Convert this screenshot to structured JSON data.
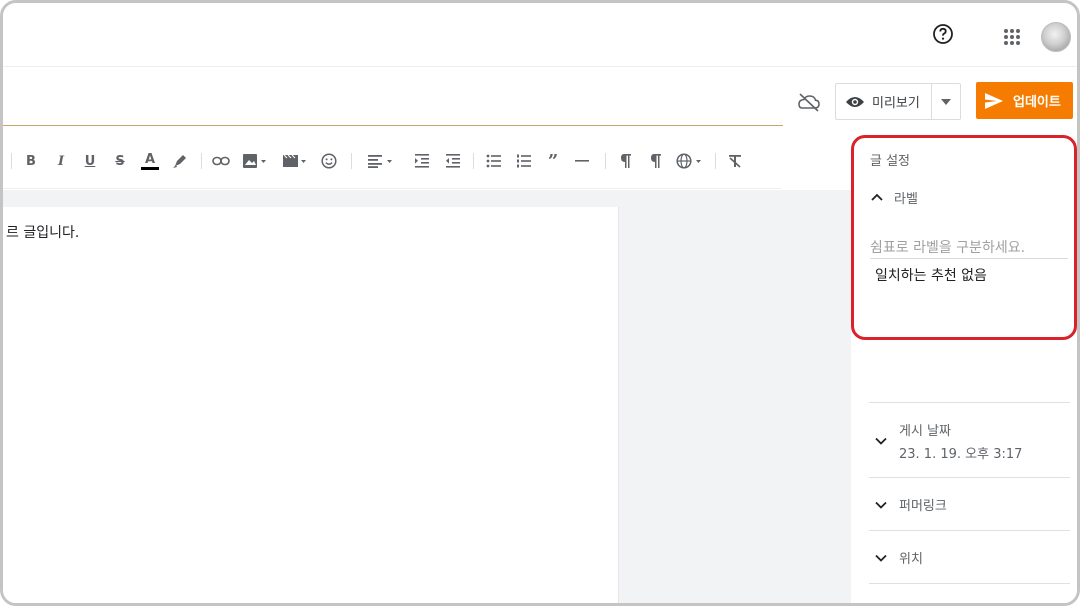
{
  "header": {
    "help_icon": "help-circle-icon",
    "apps_icon": "apps-grid-icon"
  },
  "title": {
    "value": "",
    "placeholder": ""
  },
  "actions": {
    "preview_label": "미리보기",
    "update_label": "업데이트",
    "update_color": "#f57c00"
  },
  "toolbar": {
    "bold": "B",
    "italic": "I",
    "underline": "U",
    "strike": "S",
    "text_color": "A",
    "quote": "”"
  },
  "editor": {
    "visible_text": "르 글입니다."
  },
  "settings": {
    "title": "글 설정",
    "labels": {
      "title": "라벨",
      "placeholder": "쉼표로 라벨을 구분하세요.",
      "no_match": "일치하는 추천 없음"
    },
    "sections": [
      {
        "label": "게시 날짜",
        "sub": "23. 1. 19. 오후 3:17"
      },
      {
        "label": "퍼머링크",
        "sub": ""
      },
      {
        "label": "위치",
        "sub": ""
      }
    ]
  },
  "highlight_color": "#d9222a"
}
